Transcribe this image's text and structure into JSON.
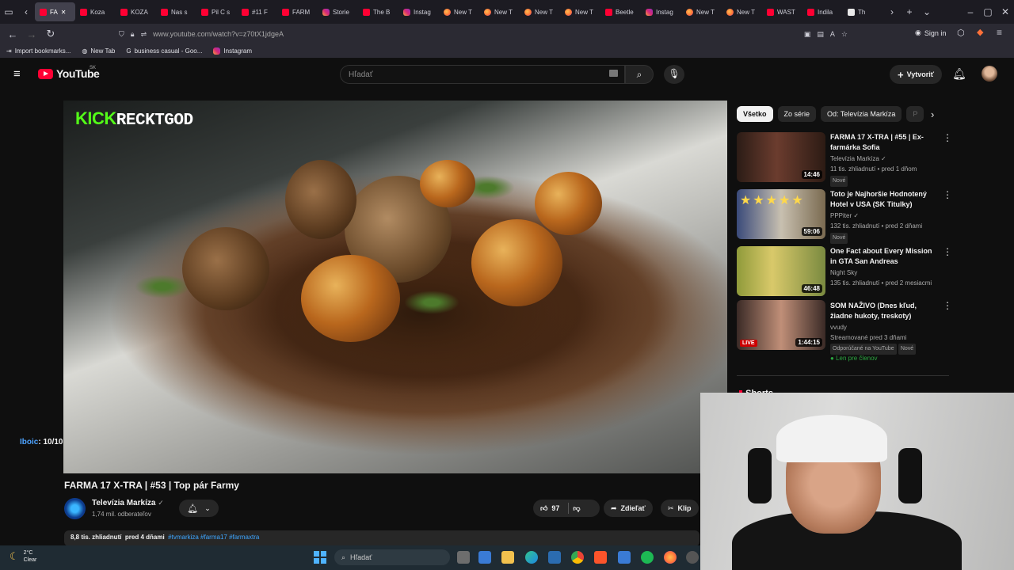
{
  "browser": {
    "tabs": [
      {
        "label": "FA",
        "favicon": "youtube-icon",
        "active": true
      },
      {
        "label": "Koza",
        "favicon": "youtube-icon"
      },
      {
        "label": "KOZA",
        "favicon": "youtube-icon"
      },
      {
        "label": "Nas s",
        "favicon": "youtube-icon"
      },
      {
        "label": "Pil C s",
        "favicon": "youtube-icon"
      },
      {
        "label": "#11 F",
        "favicon": "youtube-icon"
      },
      {
        "label": "FARM",
        "favicon": "youtube-icon"
      },
      {
        "label": "Storie",
        "favicon": "instagram-icon"
      },
      {
        "label": "The B",
        "favicon": "youtube-icon"
      },
      {
        "label": "Instag",
        "favicon": "instagram-icon"
      },
      {
        "label": "New T",
        "favicon": "firefox-icon"
      },
      {
        "label": "New T",
        "favicon": "firefox-icon"
      },
      {
        "label": "New T",
        "favicon": "firefox-icon"
      },
      {
        "label": "New T",
        "favicon": "firefox-icon"
      },
      {
        "label": "Beetle",
        "favicon": "youtube-icon"
      },
      {
        "label": "Instag",
        "favicon": "instagram-icon"
      },
      {
        "label": "New T",
        "favicon": "firefox-icon"
      },
      {
        "label": "New T",
        "favicon": "firefox-icon"
      },
      {
        "label": "WAST",
        "favicon": "youtube-icon"
      },
      {
        "label": "Indila",
        "favicon": "youtube-icon"
      },
      {
        "label": "Th",
        "favicon": "generic-icon"
      }
    ],
    "url": "www.youtube.com/watch?v=z70tX1jdgeA",
    "sign_in": "Sign in",
    "bookmarks": [
      "Import bookmarks...",
      "New Tab",
      "business casual - Goo...",
      "Instagram"
    ]
  },
  "youtube": {
    "logo_text": "YouTube",
    "region": "SK",
    "search_placeholder": "Hľadať",
    "create_label": "Vytvoriť"
  },
  "video": {
    "overlay_kick": "KICK",
    "overlay_name": "RECKTGOD",
    "chat_user": "Iboic",
    "chat_text": ": 10/10",
    "title": "FARMA 17 X-TRA | #53 | Top pár Farmy",
    "channel": "Televízia Markíza",
    "subscribers": "1,74 mil. odberateľov",
    "likes": "97",
    "share_label": "Zdieľať",
    "clip_label": "Klip",
    "views": "8,8 tis. zhliadnutí",
    "age": "pred 4 dňami",
    "tags": "#tvmarkiza #farma17 #farmaxtra"
  },
  "sidebar": {
    "chips": [
      "Všetko",
      "Zo série",
      "Od: Televízia Markíza",
      "P"
    ],
    "recommendations": [
      {
        "title": "FARMA 17 X-TRA | #55 | Ex-farmárka Sofia",
        "channel": "Televízia Markíza",
        "meta": "11 tis. zhliadnutí • pred 1 dňom",
        "badge": "Nové",
        "duration": "14:46"
      },
      {
        "title": "Toto je Najhoršie Hodnotený Hotel v USA (SK Titulky)",
        "channel": "PPPiter",
        "meta": "132 tis. zhliadnutí • pred 2 dňami",
        "badge": "Nové",
        "duration": "59:06"
      },
      {
        "title": "One Fact about Every Mission in GTA San Andreas",
        "channel": "Night Sky",
        "meta": "135 tis. zhliadnutí • pred 2 mesiacmi",
        "duration": "46:48"
      },
      {
        "title": "SOM NAŽIVO (Dnes kľud, žiadne hukoty, treskoty)",
        "channel": "vvudy",
        "meta": "Streamované pred 3 dňami",
        "badge_line": "Odporúčané na YouTube",
        "badge": "Nové",
        "members": "Len pre členov",
        "duration": "1:44:15",
        "live": "LIVE"
      }
    ],
    "shorts_heading": "Shorts"
  },
  "taskbar": {
    "temp": "2°C",
    "weather": "Clear",
    "search": "Hľadať"
  }
}
